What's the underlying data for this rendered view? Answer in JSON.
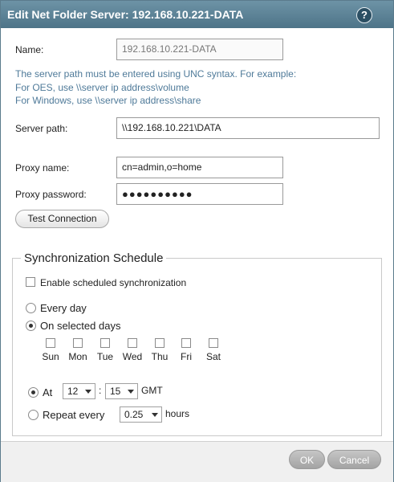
{
  "dialog": {
    "title": "Edit Net Folder Server: 192.168.10.221-DATA",
    "help_icon": "?"
  },
  "form": {
    "name_label": "Name:",
    "name_value": "192.168.10.221-DATA",
    "note_line1": "The server path must be entered using UNC syntax. For example:",
    "note_line2": "For OES, use \\\\server ip address\\volume",
    "note_line3": "For Windows, use \\\\server ip address\\share",
    "server_path_label": "Server path:",
    "server_path_value": "\\\\192.168.10.221\\DATA",
    "proxy_name_label": "Proxy name:",
    "proxy_name_value": "cn=admin,o=home",
    "proxy_password_label": "Proxy password:",
    "proxy_password_value": "●●●●●●●●●●",
    "test_connection_label": "Test Connection"
  },
  "sync": {
    "legend": "Synchronization Schedule",
    "enable_label": "Enable scheduled synchronization",
    "every_day_label": "Every day",
    "selected_days_label": "On selected days",
    "days": [
      "Sun",
      "Mon",
      "Tue",
      "Wed",
      "Thu",
      "Fri",
      "Sat"
    ],
    "at_label": "At",
    "hour": "12",
    "colon": ":",
    "minute": "15",
    "tz": "GMT",
    "repeat_label": "Repeat every",
    "repeat_value": "0.25",
    "hours_label": "hours"
  },
  "footer": {
    "ok_label": "OK",
    "cancel_label": "Cancel"
  },
  "colors": {
    "titlebar": "#5a8095",
    "note_text": "#4f7a99"
  }
}
